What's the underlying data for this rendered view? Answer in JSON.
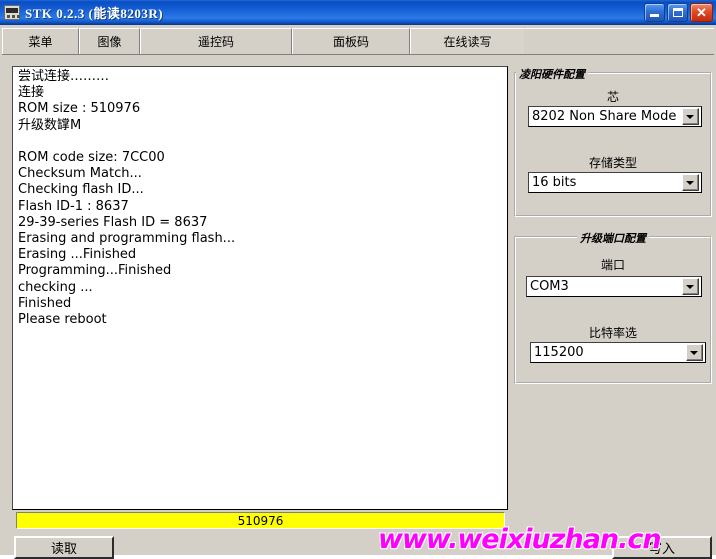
{
  "window": {
    "title": "STK  0.2.3  (能读8203R)",
    "icon": "app-icon",
    "controls": {
      "minimize": "–",
      "maximize": "□",
      "close": "✕"
    }
  },
  "menubar": {
    "tabs": [
      {
        "label": "菜单",
        "name": "menu-tab-caidan",
        "width": 77,
        "selected": false
      },
      {
        "label": "图像",
        "name": "menu-tab-tuxiang",
        "width": 61,
        "selected": false
      },
      {
        "label": "遥控码",
        "name": "menu-tab-yaokongma",
        "width": 152,
        "selected": false
      },
      {
        "label": "面板码",
        "name": "menu-tab-mianbanma",
        "width": 118,
        "selected": false
      },
      {
        "label": "在线读写",
        "name": "menu-tab-zaixianduxie",
        "width": 115,
        "selected": true
      }
    ]
  },
  "log": {
    "text": "尝试连接………\n连接\nROM size : 510976\n升级数罉M\n\nROM code size: 7CC00\nChecksum Match...\nChecking flash ID...\nFlash ID-1 : 8637\n29-39-series Flash ID = 8637\nErasing and programming flash...\nErasing ...Finished\nProgramming...Finished\nchecking ...\nFinished\nPlease reboot"
  },
  "panels": {
    "hardware": {
      "title": "凌阳硬件配置",
      "fields": [
        {
          "label": "芯",
          "name": "chip",
          "value": "8202 Non Share Mode"
        },
        {
          "label": "存储类型",
          "name": "storage-type",
          "value": "16 bits"
        }
      ]
    },
    "port": {
      "title": "升级端口配置",
      "fields": [
        {
          "label": "端口",
          "name": "port",
          "value": "COM3"
        },
        {
          "label": "比特率选",
          "name": "baudrate",
          "value": "115200"
        }
      ]
    }
  },
  "progress": {
    "value": "510976",
    "fill_color": "#ffff00"
  },
  "buttons": {
    "read": "读取",
    "write": "写入"
  },
  "watermark": {
    "text": "www.weixiuzhan.cn",
    "color": "#ff00ff"
  }
}
